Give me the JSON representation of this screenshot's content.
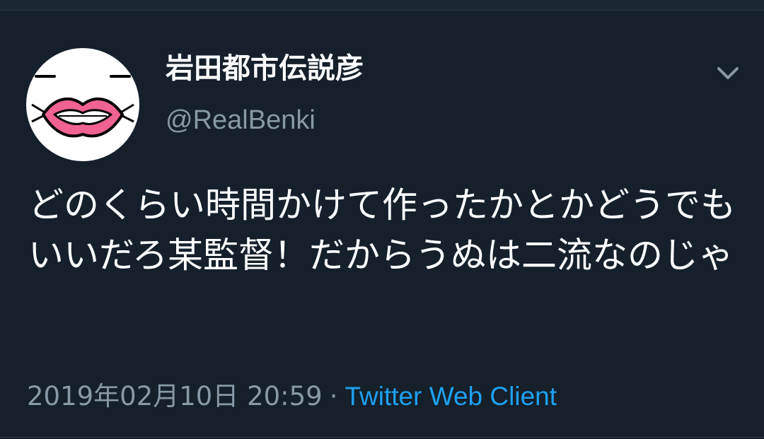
{
  "user": {
    "display_name": "岩田都市伝説彦",
    "handle": "@RealBenki",
    "avatar": "lips-face-avatar"
  },
  "tweet": {
    "text": "どのくらい時間かけて作ったかとかどうでもいいだろ某監督！だからうぬは二流なのじゃ",
    "timestamp": "2019年02月10日 20:59",
    "separator": "·",
    "source": "Twitter Web Client"
  },
  "icons": {
    "menu": "chevron-down-icon"
  },
  "colors": {
    "background": "#15202b",
    "secondary_text": "#8899a6",
    "link": "#1da1f2",
    "lips": "#f06292"
  }
}
